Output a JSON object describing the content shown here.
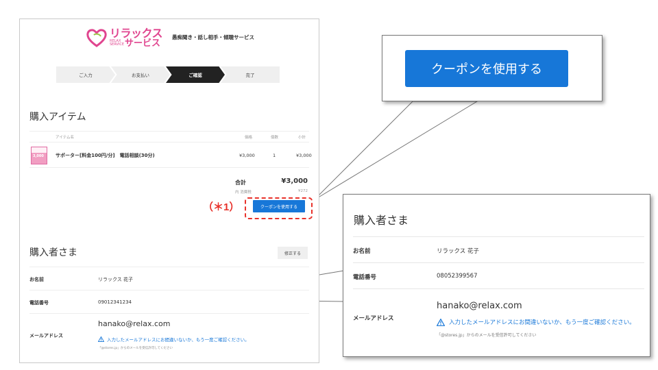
{
  "header": {
    "logo_main": "リラックス",
    "logo_en": "RELAX SERVICE",
    "logo_sub": "サービス",
    "tagline": "愚痴聞き・話し相手・傾聴サービス"
  },
  "steps": [
    "ご入力",
    "お支払い",
    "ご確認",
    "完了"
  ],
  "items_section": {
    "title": "購入アイテム",
    "columns": {
      "item": "アイテム名",
      "price": "価格",
      "qty": "個数",
      "subtotal": "小計"
    },
    "row": {
      "thumb_price": "3,000",
      "name": "サポーター[料金100円/分]　電話相談(30分)",
      "price": "¥3,000",
      "qty": "1",
      "subtotal": "¥3,000"
    },
    "total_label": "合計",
    "total_value": "¥3,000",
    "tax_label": "内 消費税",
    "tax_value": "¥272",
    "coupon_button": "クーポンを使用する"
  },
  "annotation": {
    "label": "（＊1）"
  },
  "buyer_section": {
    "title": "購入者さま",
    "edit_button": "修正する",
    "name_label": "お名前",
    "name_value": "リラックス 花子",
    "phone_label": "電話番号",
    "phone_value": "09012341234",
    "email_label": "メールアドレス",
    "email_value": "hanako@relax.com",
    "warning": "入力したメールアドレスにお間違いないか、もう一度ご確認ください。",
    "note": "「@stores.jp」からのメールを受信許可してください"
  },
  "callout_coupon": {
    "button": "クーポンを使用する"
  },
  "callout_buyer": {
    "title": "購入者さま",
    "name_label": "お名前",
    "name_value": "リラックス 花子",
    "phone_label": "電話番号",
    "phone_value": "08052399567",
    "email_label": "メールアドレス",
    "email_value": "hanako@relax.com",
    "warning": "入力したメールアドレスにお間違いないか、もう一度ご確認ください。",
    "note": "「@stores.jp」からのメールを受信許可してください"
  },
  "colors": {
    "accent": "#1777d8",
    "brand_pink": "#e0458f",
    "annotation_red": "#e8312a"
  }
}
